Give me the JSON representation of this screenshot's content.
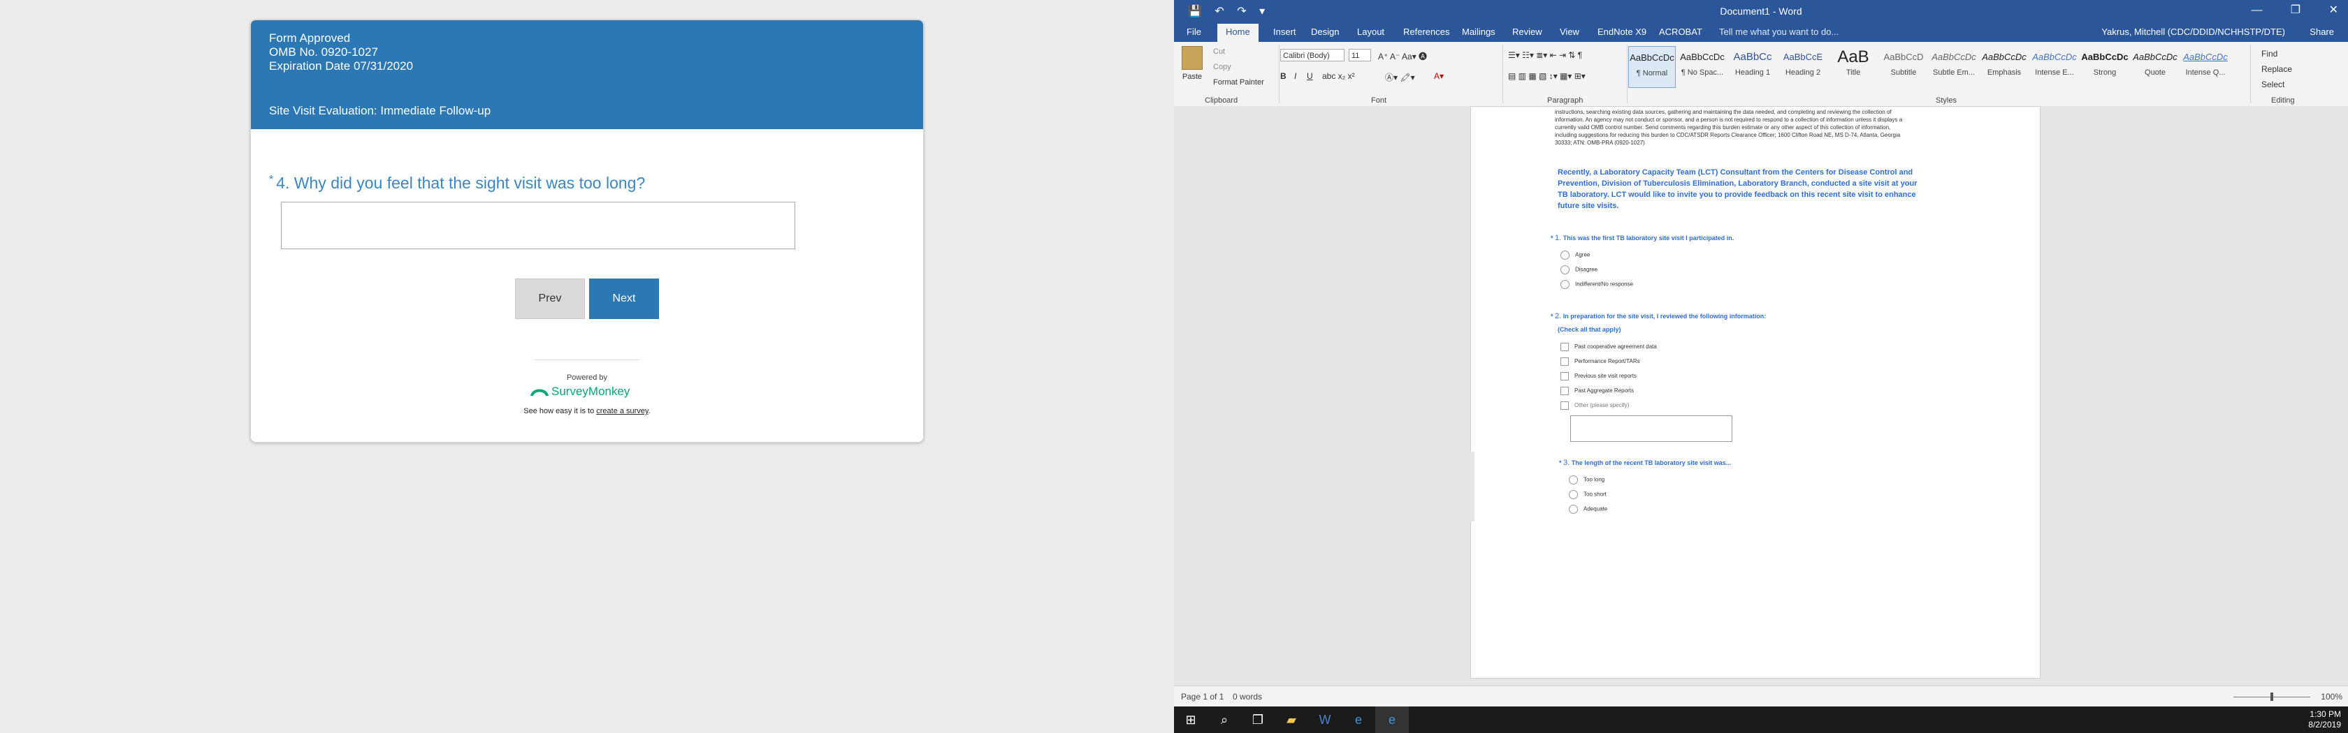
{
  "survey": {
    "header_lines": [
      "Form Approved",
      "OMB No. 0920-1027",
      "Expiration Date 07/31/2020"
    ],
    "title": "Site Visit Evaluation: Immediate Follow-up",
    "question_marker": "*",
    "question": "4. Why did you feel that the sight visit was too long?",
    "answer_value": "",
    "prev_label": "Prev",
    "next_label": "Next",
    "powered_by": "Powered by",
    "brand": "SurveyMonkey",
    "see_how_prefix": "See how easy it is to ",
    "see_how_link": "create a survey",
    "see_how_suffix": ".",
    "colors": {
      "header": "#2b78b5",
      "question": "#3a86c4",
      "brand": "#00a878"
    }
  },
  "word": {
    "doc_title": "Document1 - Word",
    "qat": {
      "save": "💾",
      "undo": "↶",
      "redo": "↷",
      "customize": "▾"
    },
    "window_controls": {
      "minimize": "—",
      "restore": "❐",
      "close": "✕"
    },
    "tabs": [
      "File",
      "Home",
      "Insert",
      "Design",
      "Layout",
      "References",
      "Mailings",
      "Review",
      "View",
      "EndNote X9",
      "ACROBAT"
    ],
    "active_tab": "Home",
    "tell_me": "Tell me what you want to do...",
    "user": "Yakrus, Mitchell (CDC/DDID/NCHHSTP/DTE)",
    "share": "Share",
    "ribbon": {
      "paste": "Paste",
      "cut": "Cut",
      "copy": "Copy",
      "format_painter": "Format Painter",
      "font_name": "Calibri (Body)",
      "font_size": "11",
      "groups": {
        "clipboard": "Clipboard",
        "font": "Font",
        "paragraph": "Paragraph",
        "styles": "Styles",
        "editing": "Editing"
      },
      "styles": [
        {
          "sample": "AaBbCcDc",
          "name": "¶ Normal"
        },
        {
          "sample": "AaBbCcDc",
          "name": "¶ No Spac..."
        },
        {
          "sample": "AaBbCc",
          "name": "Heading 1"
        },
        {
          "sample": "AaBbCcE",
          "name": "Heading 2"
        },
        {
          "sample": "AaB",
          "name": "Title"
        },
        {
          "sample": "AaBbCcD",
          "name": "Subtitle"
        },
        {
          "sample": "AaBbCcDc",
          "name": "Subtle Em..."
        },
        {
          "sample": "AaBbCcDc",
          "name": "Emphasis"
        },
        {
          "sample": "AaBbCcDc",
          "name": "Intense E..."
        },
        {
          "sample": "AaBbCcDc",
          "name": "Strong"
        },
        {
          "sample": "AaBbCcDc",
          "name": "Quote"
        },
        {
          "sample": "AaBbCcDc",
          "name": "Intense Q..."
        }
      ],
      "find": "Find",
      "replace": "Replace",
      "select": "Select"
    },
    "document": {
      "burden_lines": [
        "instructions, searching existing data sources, gathering and maintaining the data needed, and completing and reviewing the collection of",
        "information. An agency may not conduct or sponsor, and a person is not required to respond to a collection of information unless it displays a",
        "currently valid OMB control number. Send comments regarding this burden estimate or any other aspect of this collection of information,",
        "including suggestions for reducing this burden to CDC/ATSDR Reports Clearance Officer; 1600 Clifton Road NE, MS D-74, Atlanta, Georgia",
        "30333; ATN: OMB-PRA (0920-1027)"
      ],
      "intro_lines": [
        "Recently, a Laboratory Capacity Team (LCT) Consultant from the Centers for Disease Control and",
        "Prevention, Division of Tuberculosis Elimination, Laboratory Branch, conducted a site visit at your",
        "TB laboratory. LCT would like to invite you to provide feedback on this recent site visit to enhance",
        "future site visits."
      ],
      "q1": {
        "num": "1.",
        "text": "This was the first TB laboratory site visit I participated in.",
        "options": [
          "Agree",
          "Disagree",
          "Indifferent/No response"
        ]
      },
      "q2": {
        "num": "2.",
        "text": "In preparation for the site visit, I reviewed the following information:",
        "note": "(Check all that apply)",
        "options": [
          "Past cooperative agreement data",
          "Performance Report/TARs",
          "Previous site visit reports",
          "Past Aggregate Reports",
          "Other (please specify)"
        ]
      },
      "q3": {
        "num": "3.",
        "text": "The length of the recent TB laboratory site visit was...",
        "options": [
          "Too long",
          "Too short",
          "Adequate"
        ]
      }
    },
    "status": {
      "page": "Page 1 of 1",
      "words": "0 words",
      "zoom": "100%"
    },
    "taskbar": {
      "time": "1:30 PM",
      "date": "8/2/2019"
    }
  }
}
